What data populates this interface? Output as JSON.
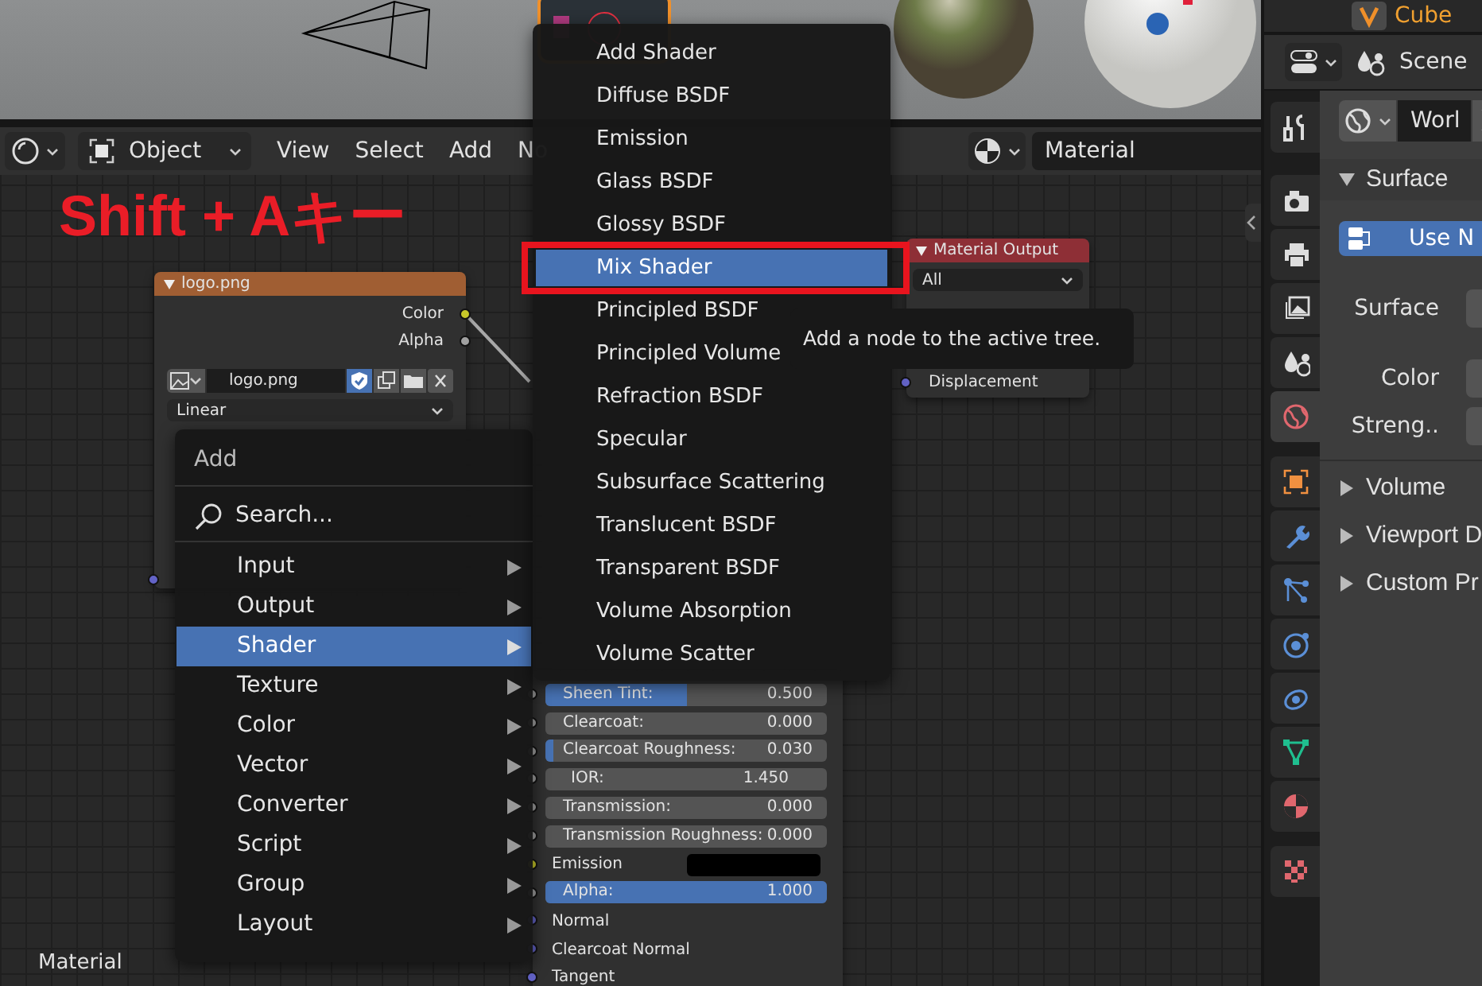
{
  "outliner": {
    "item": "Cube"
  },
  "properties_header": {
    "scene": "Scene"
  },
  "node_editor": {
    "header": {
      "mode": "Object",
      "menus": [
        "View",
        "Select",
        "Add",
        "No"
      ],
      "shader_type": "Material"
    },
    "annotation": "Shift + Aキー",
    "tree_label": "Material",
    "image_node": {
      "title": "logo.png",
      "outputs": [
        "Color",
        "Alpha"
      ],
      "image": "logo.png",
      "fake_user": true,
      "interpolation": "Linear"
    },
    "principled_node": {
      "rows": [
        {
          "kind": "slider",
          "label": "Sheen Tint:",
          "value": "0.500",
          "level": 0.5
        },
        {
          "kind": "slider",
          "label": "Clearcoat:",
          "value": "0.000",
          "level": 0
        },
        {
          "kind": "slider",
          "label": "Clearcoat Roughness:",
          "value": "0.030",
          "level": 0.03
        },
        {
          "kind": "number",
          "label": "IOR:",
          "value": "1.450"
        },
        {
          "kind": "slider",
          "label": "Transmission:",
          "value": "0.000",
          "level": 0
        },
        {
          "kind": "slider",
          "label": "Transmission Roughness:",
          "value": "0.000",
          "level": 0
        },
        {
          "kind": "color",
          "label": "Emission"
        },
        {
          "kind": "slider",
          "label": "Alpha:",
          "value": "1.000",
          "level": 1
        },
        {
          "kind": "socket",
          "label": "Normal"
        },
        {
          "kind": "socket",
          "label": "Clearcoat Normal"
        },
        {
          "kind": "socket",
          "label": "Tangent"
        }
      ]
    },
    "output_node": {
      "title": "Material Output",
      "target": "All",
      "inputs": [
        "Displacement"
      ]
    }
  },
  "add_menu": {
    "title": "Add",
    "search": "Search...",
    "items": [
      {
        "label": "Input",
        "selected": false
      },
      {
        "label": "Output",
        "selected": false
      },
      {
        "label": "Shader",
        "selected": true
      },
      {
        "label": "Texture",
        "selected": false
      },
      {
        "label": "Color",
        "selected": false
      },
      {
        "label": "Vector",
        "selected": false
      },
      {
        "label": "Converter",
        "selected": false
      },
      {
        "label": "Script",
        "selected": false
      },
      {
        "label": "Group",
        "selected": false
      },
      {
        "label": "Layout",
        "selected": false
      }
    ]
  },
  "shader_menu": {
    "highlight_box": true,
    "items": [
      {
        "label": "Add Shader",
        "selected": false
      },
      {
        "label": "Diffuse BSDF",
        "selected": false
      },
      {
        "label": "Emission",
        "selected": false
      },
      {
        "label": "Glass BSDF",
        "selected": false
      },
      {
        "label": "Glossy BSDF",
        "selected": false
      },
      {
        "label": "Mix Shader",
        "selected": true
      },
      {
        "label": "Principled BSDF",
        "selected": false
      },
      {
        "label": "Principled Volume",
        "selected": false
      },
      {
        "label": "Refraction BSDF",
        "selected": false
      },
      {
        "label": "Specular",
        "selected": false
      },
      {
        "label": "Subsurface Scattering",
        "selected": false
      },
      {
        "label": "Translucent BSDF",
        "selected": false
      },
      {
        "label": "Transparent BSDF",
        "selected": false
      },
      {
        "label": "Volume Absorption",
        "selected": false
      },
      {
        "label": "Volume Scatter",
        "selected": false
      }
    ]
  },
  "tooltip": "Add a node to the active tree.",
  "properties": {
    "world": "Worl",
    "tab_groups": [
      [
        {
          "kind": "tool",
          "selected": false
        }
      ],
      [
        {
          "kind": "render",
          "selected": false
        },
        {
          "kind": "output",
          "selected": false
        },
        {
          "kind": "view_layer",
          "selected": false
        },
        {
          "kind": "scene",
          "selected": false
        },
        {
          "kind": "world",
          "selected": true
        }
      ],
      [
        {
          "kind": "object",
          "selected": false
        },
        {
          "kind": "modifier",
          "selected": false
        },
        {
          "kind": "particles",
          "selected": false
        },
        {
          "kind": "physics",
          "selected": false
        },
        {
          "kind": "constraints",
          "selected": false
        },
        {
          "kind": "data",
          "selected": false
        },
        {
          "kind": "material",
          "selected": false
        }
      ],
      [
        {
          "kind": "texture",
          "selected": false
        }
      ]
    ],
    "panels": [
      {
        "title": "Surface",
        "expanded": true,
        "button": "Use N",
        "fields": [
          "Surface",
          "Color",
          "Streng.."
        ]
      },
      {
        "title": "Volume",
        "expanded": false
      },
      {
        "title": "Viewport D",
        "expanded": false
      },
      {
        "title": "Custom Pr",
        "expanded": false
      }
    ]
  }
}
